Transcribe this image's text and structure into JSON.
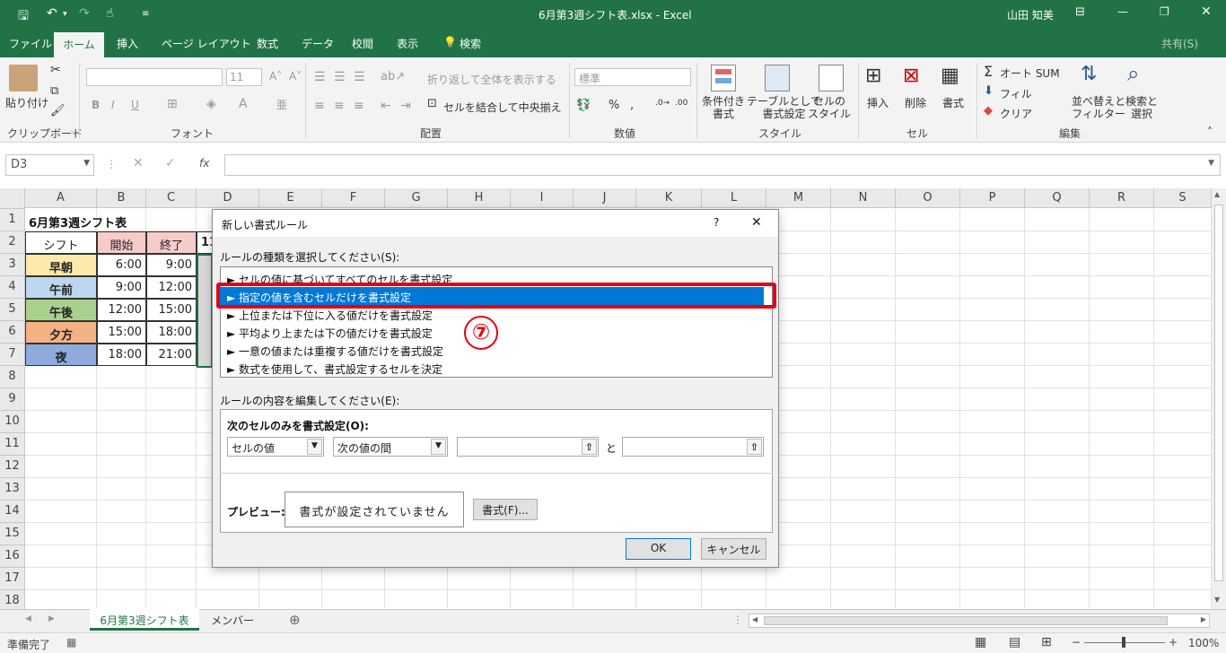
{
  "window": {
    "title": "6月第3週シフト表.xlsx - Excel",
    "user": "山田 知美",
    "share": "共有(S)"
  },
  "tabs": [
    "ファイル",
    "ホーム",
    "挿入",
    "ページ レイアウト",
    "数式",
    "データ",
    "校閲",
    "表示",
    "検索"
  ],
  "ribbon": {
    "clipboard": {
      "paste": "貼り付け",
      "label": "クリップボード"
    },
    "font": {
      "size": "11",
      "bold": "B",
      "italic": "I",
      "underline": "U",
      "label": "フォント"
    },
    "alignment": {
      "wrap": "折り返して全体を表示する",
      "merge": "セルを結合して中央揃え",
      "label": "配置"
    },
    "number": {
      "format": "標準",
      "percent": "%",
      "label": "数値"
    },
    "styles": {
      "conditional": "条件付き\n書式",
      "table": "テーブルとして\n書式設定",
      "cell": "セルの\nスタイル",
      "label": "スタイル"
    },
    "cells": {
      "insert": "挿入",
      "delete": "削除",
      "format": "書式",
      "label": "セル"
    },
    "editing": {
      "autosum": "オート SUM",
      "fill": "フィル",
      "clear": "クリア",
      "sort": "並べ替えと\nフィルター",
      "find": "検索と\n選択",
      "label": "編集"
    }
  },
  "formula_bar": {
    "name_box": "D3",
    "fx": "fx"
  },
  "columns": [
    "A",
    "B",
    "C",
    "D",
    "E",
    "F",
    "G",
    "H",
    "I",
    "J",
    "K",
    "L",
    "M",
    "N",
    "O",
    "P",
    "Q",
    "R",
    "S"
  ],
  "rows": [
    "1",
    "2",
    "3",
    "4",
    "5",
    "6",
    "7",
    "8",
    "9",
    "10",
    "11",
    "12",
    "13",
    "14",
    "15",
    "16",
    "17",
    "18"
  ],
  "sheet": {
    "title": "6月第3週シフト表",
    "headers": [
      "シフト",
      "開始",
      "終了",
      "11"
    ],
    "data": [
      {
        "shift": "早朝",
        "start": "6:00",
        "end": "9:00",
        "color": "#fde9a9"
      },
      {
        "shift": "午前",
        "start": "9:00",
        "end": "12:00",
        "color": "#bdd7ee"
      },
      {
        "shift": "午後",
        "start": "12:00",
        "end": "15:00",
        "color": "#a9d18e"
      },
      {
        "shift": "夕方",
        "start": "15:00",
        "end": "18:00",
        "color": "#f4b183"
      },
      {
        "shift": "夜",
        "start": "18:00",
        "end": "21:00",
        "color": "#8faadc"
      }
    ]
  },
  "dialog": {
    "title": "新しい書式ルール",
    "help": "?",
    "close": "✕",
    "type_label": "ルールの種類を選択してください(S):",
    "rule_types": [
      "► セルの値に基づいてすべてのセルを書式設定",
      "► 指定の値を含むセルだけを書式設定",
      "► 上位または下位に入る値だけを書式設定",
      "► 平均より上または下の値だけを書式設定",
      "► 一意の値または重複する値だけを書式設定",
      "► 数式を使用して、書式設定するセルを決定"
    ],
    "edit_label": "ルールの内容を編集してください(E):",
    "format_only": "次のセルのみを書式設定(O):",
    "condition1": "セルの値",
    "condition2": "次の値の間",
    "and": "と",
    "preview_label": "プレビュー:",
    "preview_text": "書式が設定されていません",
    "format_button": "書式(F)...",
    "ok": "OK",
    "cancel": "キャンセル"
  },
  "annotation": {
    "step": "⑦",
    "color": "#e60012"
  },
  "sheet_tabs": [
    "6月第3週シフト表",
    "メンバー"
  ],
  "status": {
    "ready": "準備完了",
    "zoom": "100%"
  }
}
